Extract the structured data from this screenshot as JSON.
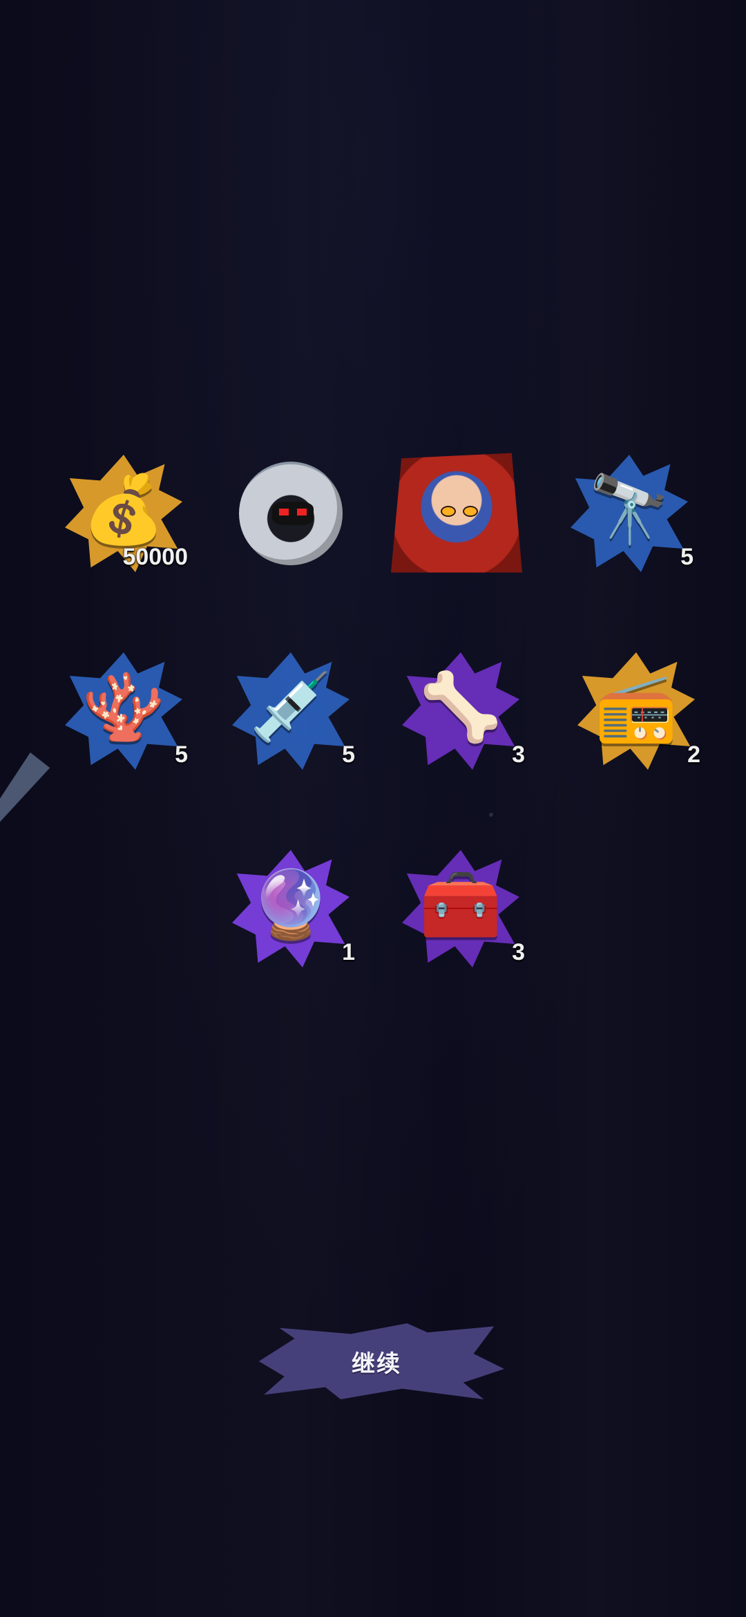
{
  "rewards": [
    {
      "name": "coin-bag",
      "icon": "coin-bag-icon",
      "glyph": "💰",
      "qty": "50000",
      "burst": "#e3a12a"
    },
    {
      "name": "robot-drone",
      "icon": "robot-head-icon",
      "glyph": "",
      "qty": "",
      "burst": "#3b7cc4"
    },
    {
      "name": "character-portrait",
      "icon": "hooded-girl-portrait-icon",
      "glyph": "",
      "qty": "",
      "burst": "#b3271d"
    },
    {
      "name": "telescope",
      "icon": "telescope-icon",
      "glyph": "🔭",
      "qty": "5",
      "burst": "#2b5fb8"
    },
    {
      "name": "crystal-shell",
      "icon": "crystal-shell-icon",
      "glyph": "🪸",
      "qty": "5",
      "burst": "#2b5fb8"
    },
    {
      "name": "syringe-card",
      "icon": "syringe-icon",
      "glyph": "💉",
      "qty": "5",
      "burst": "#2b5fb8"
    },
    {
      "name": "vertebra-bone",
      "icon": "bone-icon",
      "glyph": "🦴",
      "qty": "3",
      "burst": "#6b2fc0"
    },
    {
      "name": "radio-device",
      "icon": "radio-icon",
      "glyph": "📻",
      "qty": "2",
      "burst": "#e3a12a"
    },
    {
      "name": "spirit-flame",
      "icon": "spirit-flame-icon",
      "glyph": "🔮",
      "qty": "1",
      "burst": "#7b3fe0"
    },
    {
      "name": "treasure-chest",
      "icon": "chest-icon",
      "glyph": "🧰",
      "qty": "3",
      "burst": "#6b2fc0"
    }
  ],
  "continue_button": {
    "label": "继续"
  }
}
